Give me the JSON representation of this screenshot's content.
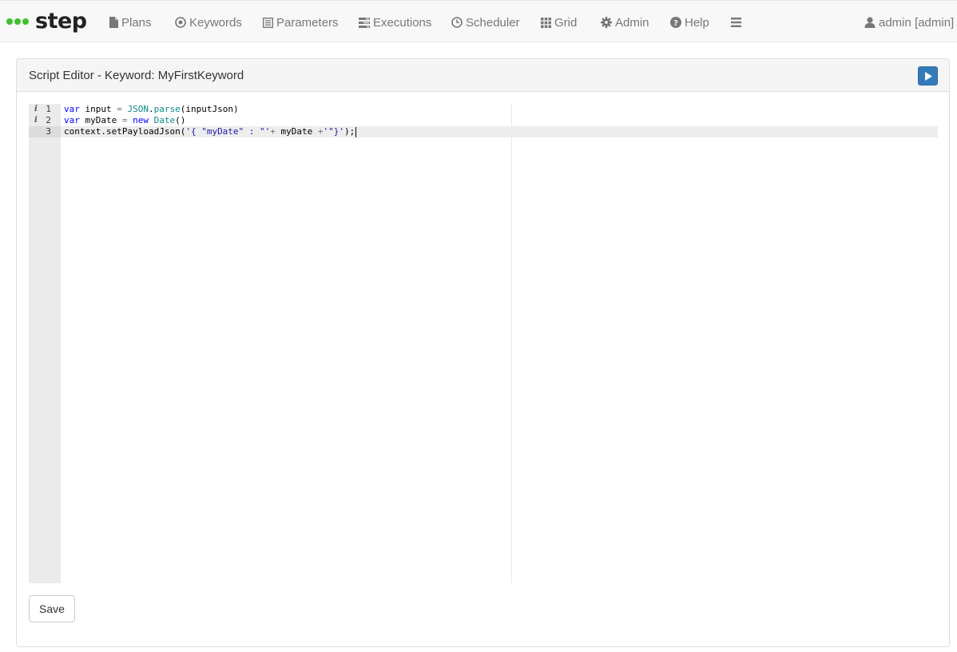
{
  "navbar": {
    "brand": "step",
    "items": [
      {
        "label": "Plans",
        "icon": "file-icon"
      },
      {
        "label": "Keywords",
        "icon": "target-icon"
      },
      {
        "label": "Parameters",
        "icon": "list-icon"
      },
      {
        "label": "Executions",
        "icon": "tasks-icon"
      },
      {
        "label": "Scheduler",
        "icon": "clock-icon"
      },
      {
        "label": "Grid",
        "icon": "grid-icon"
      },
      {
        "label": "Admin",
        "icon": "gear-icon"
      },
      {
        "label": "Help",
        "icon": "question-icon"
      }
    ],
    "menu_icon": "hamburger-icon",
    "user": {
      "label": "admin [admin]",
      "icon": "user-icon"
    }
  },
  "panel": {
    "title": "Script Editor - Keyword: MyFirstKeyword",
    "run_icon": "play-icon"
  },
  "editor": {
    "lines": [
      {
        "number": "1",
        "info": "i",
        "text": "var input = JSON.parse(inputJson)"
      },
      {
        "number": "2",
        "info": "i",
        "text": "var myDate = new Date()"
      },
      {
        "number": "3",
        "info": "",
        "text": "context.setPayloadJson('{ \"myDate\" : \"'+ myDate +'\"}');"
      }
    ],
    "active_line": 3
  },
  "actions": {
    "save_label": "Save"
  },
  "colors": {
    "brand_dots": "#3ec02e",
    "primary": "#337ab7"
  }
}
